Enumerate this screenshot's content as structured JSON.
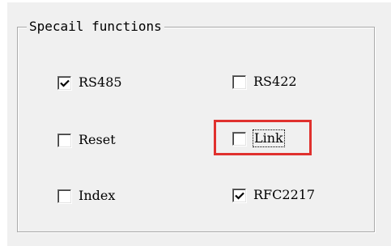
{
  "groupbox": {
    "title": "Specail functions"
  },
  "checkboxes": [
    {
      "label": "RS485",
      "checked": true
    },
    {
      "label": "RS422",
      "checked": false
    },
    {
      "label": "Reset",
      "checked": false
    },
    {
      "label": "Link",
      "checked": false
    },
    {
      "label": "Index",
      "checked": false
    },
    {
      "label": "RFC2217",
      "checked": true
    }
  ],
  "highlight": {
    "target": "Link",
    "color": "#e0312e"
  }
}
